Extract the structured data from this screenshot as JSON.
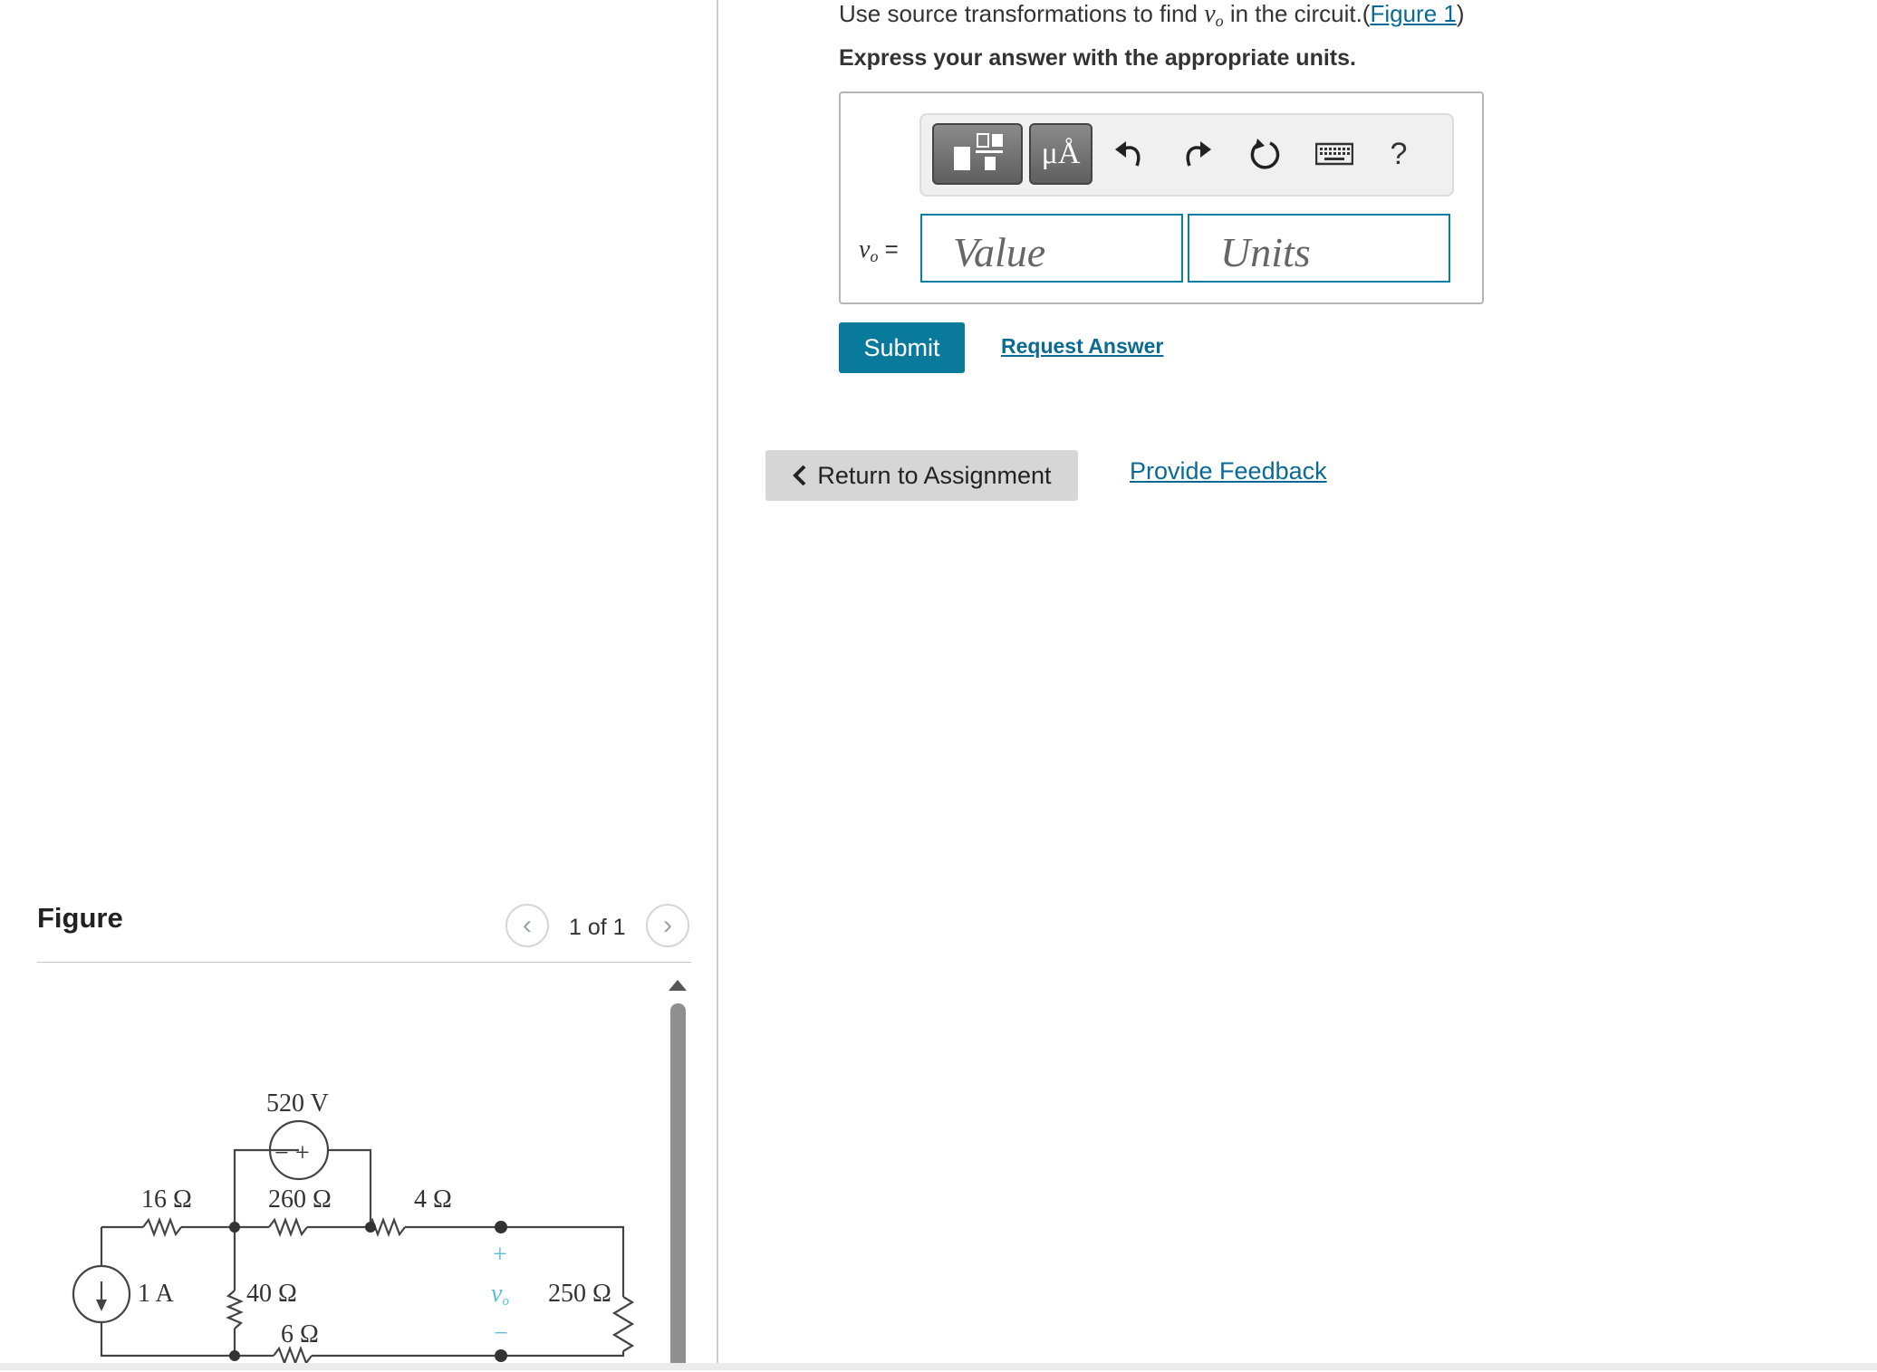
{
  "question": {
    "prefix": "Use source transformations to find ",
    "variable": "v",
    "variable_sub": "o",
    "suffix": " in the circuit.(",
    "figure_link": "Figure 1",
    "close": ")",
    "instruction": "Express your answer with the appropriate units."
  },
  "toolbar": {
    "templates_icon": "templates-icon",
    "units_label": "μÅ",
    "undo_icon": "undo-icon",
    "redo_icon": "redo-icon",
    "reset_icon": "reset-icon",
    "keyboard_icon": "keyboard-icon",
    "help_label": "?"
  },
  "answer": {
    "var": "v",
    "var_sub": "o",
    "equals": " =",
    "value_placeholder": "Value",
    "units_placeholder": "Units"
  },
  "actions": {
    "submit": "Submit",
    "request_answer": "Request Answer",
    "return_to_assignment": "Return to Assignment",
    "provide_feedback": "Provide Feedback"
  },
  "figure": {
    "heading": "Figure",
    "pager": "1 of 1",
    "circuit_labels": {
      "v_source": "520 V",
      "r16": "16 Ω",
      "r260": "260 Ω",
      "r4": "4 Ω",
      "i_source": "1 A",
      "r40": "40 Ω",
      "r6": "6 Ω",
      "r250": "250 Ω",
      "vo_plus": "+",
      "vo_minus": "−",
      "vo_sign_minus": "−",
      "vo_sign_plus": "+",
      "vo": "v",
      "vo_sub": "o"
    }
  },
  "colors": {
    "link": "#0a6a96",
    "submit_bg": "#0a7a9c",
    "field_border": "#0a7fa5",
    "vo_label": "#5bbfd8"
  }
}
